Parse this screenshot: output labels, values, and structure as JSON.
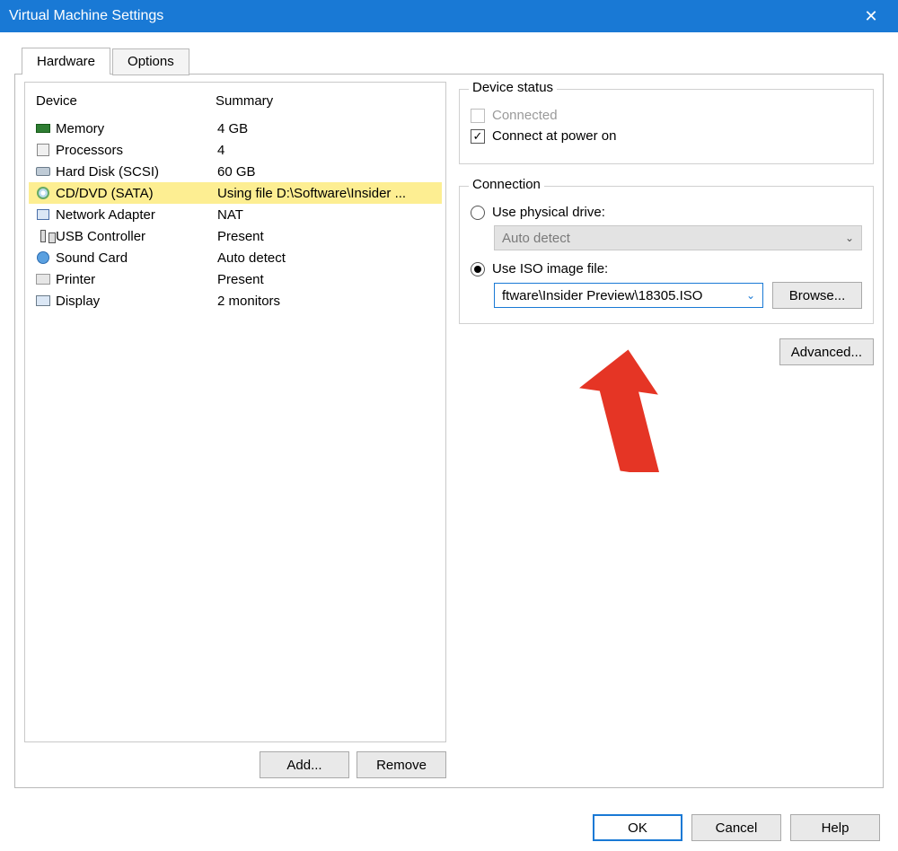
{
  "window": {
    "title": "Virtual Machine Settings"
  },
  "tabs": {
    "hardware": "Hardware",
    "options": "Options"
  },
  "list": {
    "header_device": "Device",
    "header_summary": "Summary",
    "rows": [
      {
        "name": "Memory",
        "summary": "4 GB"
      },
      {
        "name": "Processors",
        "summary": "4"
      },
      {
        "name": "Hard Disk (SCSI)",
        "summary": "60 GB"
      },
      {
        "name": "CD/DVD (SATA)",
        "summary": "Using file D:\\Software\\Insider ..."
      },
      {
        "name": "Network Adapter",
        "summary": "NAT"
      },
      {
        "name": "USB Controller",
        "summary": "Present"
      },
      {
        "name": "Sound Card",
        "summary": "Auto detect"
      },
      {
        "name": "Printer",
        "summary": "Present"
      },
      {
        "name": "Display",
        "summary": "2 monitors"
      }
    ],
    "add": "Add...",
    "remove": "Remove"
  },
  "status": {
    "legend": "Device status",
    "connected": "Connected",
    "connect_at_power_on": "Connect at power on"
  },
  "connection": {
    "legend": "Connection",
    "use_physical": "Use physical drive:",
    "physical_value": "Auto detect",
    "use_iso": "Use ISO image file:",
    "iso_value": "ftware\\Insider Preview\\18305.ISO",
    "browse": "Browse..."
  },
  "advanced": "Advanced...",
  "footer": {
    "ok": "OK",
    "cancel": "Cancel",
    "help": "Help"
  }
}
